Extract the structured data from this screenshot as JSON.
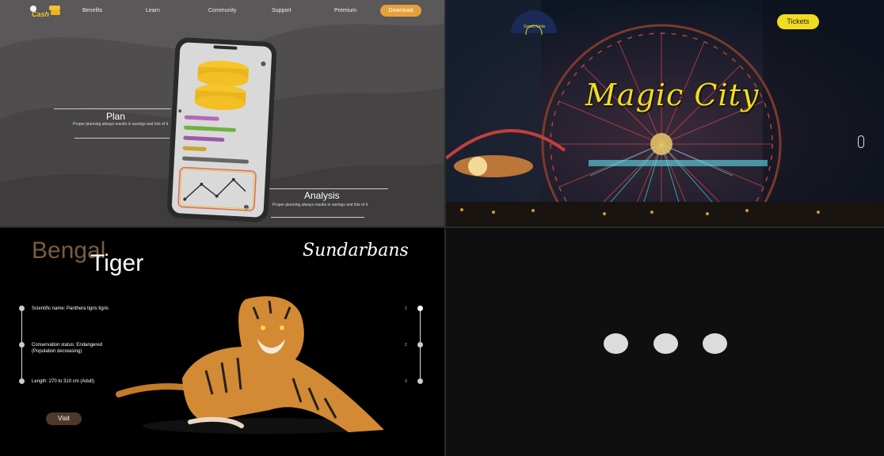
{
  "panel_money": {
    "logo_text": "Cash",
    "nav": [
      "Benefits",
      "Learn",
      "Community",
      "Support",
      "Premium"
    ],
    "download_label": "Download",
    "plan": {
      "title": "Plan",
      "desc": "Proper planning always results in savings and lots of it"
    },
    "analysis": {
      "title": "Analysis",
      "desc": "Proper planning always results in savings and lots of it"
    },
    "bar_colors": [
      "#b567b6",
      "#6fb13e",
      "#9b59a8",
      "#cfa32b",
      "#666666"
    ],
    "accent": "#e4a13a"
  },
  "panel_park": {
    "logo_text": "Grown Units",
    "tickets_label": "Tickets",
    "headline": "Magic City",
    "accent": "#f1dc1f"
  },
  "panel_tiger": {
    "title_word1": "Bengal",
    "title_word2": "Tiger",
    "brand": "Sundarbans",
    "facts": [
      {
        "line1": "Scientific name: Panthera tigris tigris",
        "line2": ""
      },
      {
        "line1": "Conservation status: Endangered",
        "line2": "(Population decreasing)"
      },
      {
        "line1": "Length: 270 to 310 cm (Adult)",
        "line2": ""
      }
    ],
    "steps": [
      "1",
      "2",
      "3"
    ],
    "visit_label": "Visit",
    "accent": "#7b5c3f"
  },
  "panel_loading": {
    "dots": 3,
    "dot_color": "#dcdcdc"
  }
}
